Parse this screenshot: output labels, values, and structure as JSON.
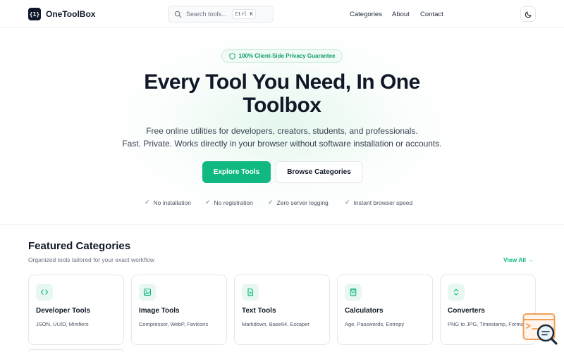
{
  "header": {
    "logo_mark": "{1}",
    "brand": "OneToolBox",
    "search_placeholder": "Search tools...",
    "search_shortcut": "Ctrl K",
    "nav": [
      "Categories",
      "About",
      "Contact"
    ],
    "theme_icon": "moon-icon"
  },
  "hero": {
    "badge": "100% Client-Side Privacy Guarantee",
    "title_line1": "Every Tool You Need, In One",
    "title_line2": "Toolbox",
    "subtitle_line1": "Free online utilities for developers, creators, students, and professionals.",
    "subtitle_line2": "Fast. Private. Works directly in your browser without software installation or accounts.",
    "primary_button": "Explore Tools",
    "secondary_button": "Browse Categories",
    "features": [
      "No installation",
      "No registration",
      "Zero server logging",
      "Instant browser speed"
    ]
  },
  "categories": {
    "title": "Featured Categories",
    "subtitle": "Organized tools tailored for your exact workflow",
    "view_all": "View All →",
    "items": [
      {
        "title": "Developer Tools",
        "desc": "JSON, UUID, Minifiers",
        "icon": "code-icon"
      },
      {
        "title": "Image Tools",
        "desc": "Compressor, WebP, Favicons",
        "icon": "image-icon"
      },
      {
        "title": "Text Tools",
        "desc": "Markdown, Base64, Escaper",
        "icon": "document-icon"
      },
      {
        "title": "Calculators",
        "desc": "Age, Passwords, Entropy",
        "icon": "calculator-icon"
      },
      {
        "title": "Converters",
        "desc": "PNG to JPG, Timestamp, Formats",
        "icon": "convert-arrows-icon"
      }
    ]
  },
  "colors": {
    "accent": "#10b981",
    "dark": "#0f172a",
    "badge_text": "#0f9d6e"
  }
}
